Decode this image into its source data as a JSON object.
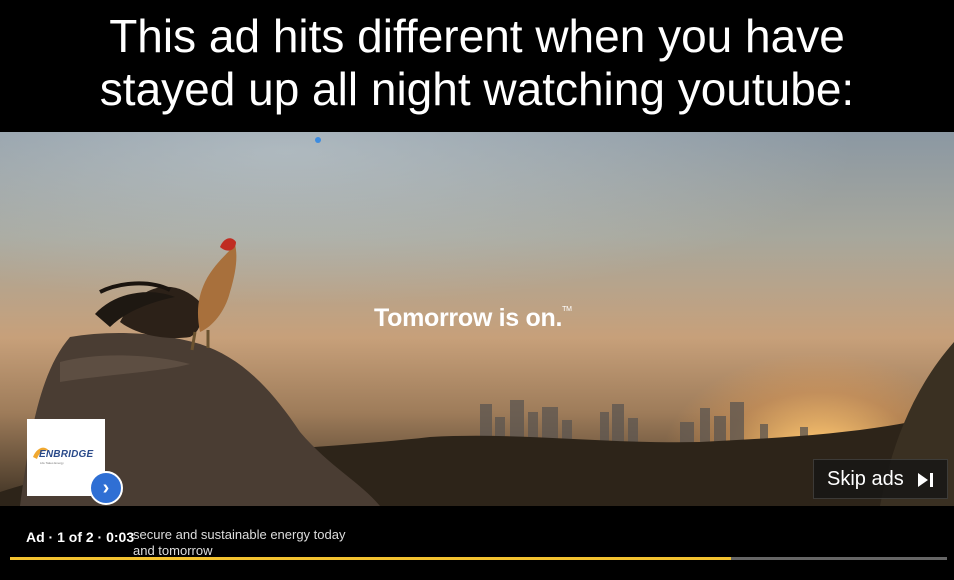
{
  "caption": {
    "line1": "This ad hits different when you have",
    "line2": "stayed up all night watching youtube:"
  },
  "video": {
    "tagline": "Tomorrow is on.",
    "trademark": "TM"
  },
  "brand": {
    "name": "ENBRIDGE",
    "tagline": "Life Takes Energy"
  },
  "player": {
    "skip_label": "Skip ads",
    "ad_counter": "Ad · 1 of 2 · 0:03",
    "description_line1": "secure and sustainable energy today",
    "description_line2": "and tomorrow",
    "progress": 0.77,
    "accent_color": "#f3c230",
    "info_icon": "chevron-right-icon"
  }
}
